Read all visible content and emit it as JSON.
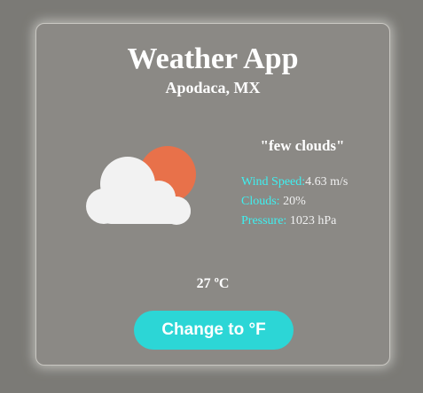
{
  "app": {
    "title": "Weather App",
    "location": "Apodaca, MX"
  },
  "weather": {
    "description": "\"few clouds\"",
    "icon": "few-clouds-day-icon",
    "details": [
      {
        "label": "Wind Speed:",
        "value": "4.63 m/s"
      },
      {
        "label": "Clouds:",
        "value": " 20%"
      },
      {
        "label": "Pressure:",
        "value": " 1023 hPa"
      }
    ],
    "temperature": "27 ºC"
  },
  "controls": {
    "toggle_label": "Change to °F"
  },
  "colors": {
    "page_background": "#7b7a76",
    "card_background": "#8b8985",
    "accent_cyan": "#2cd6d6",
    "label_cyan": "#3ef0f0",
    "sun_orange": "#e8714a",
    "cloud_white": "#f2f2f2"
  }
}
